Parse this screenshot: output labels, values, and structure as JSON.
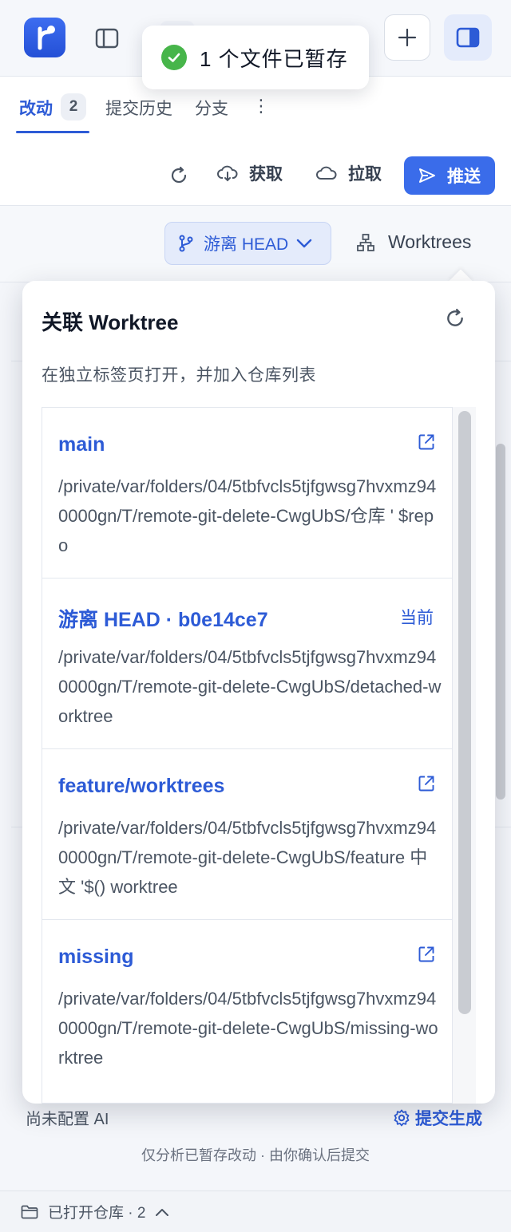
{
  "app": {
    "toast": {
      "message": "1 个文件已暂存"
    }
  },
  "tabs": [
    {
      "label": "改动",
      "badge": "2",
      "active": true
    },
    {
      "label": "提交历史"
    },
    {
      "label": "分支"
    }
  ],
  "toolbar": {
    "fetch_label": "获取",
    "pull_label": "拉取",
    "push_label": "推送"
  },
  "branch": {
    "head_label": "游离 HEAD",
    "worktrees_label": "Worktrees"
  },
  "popover": {
    "title": "关联 Worktree",
    "subtitle": "在独立标签页打开，并加入仓库列表",
    "worktrees": [
      {
        "name": "main",
        "path": "/private/var/folders/04/5tbfvcls5tjfgwsg7hvxmz940000gn/T/remote-git-delete-CwgUbS/仓库 ' $repo",
        "current": false
      },
      {
        "name": "游离 HEAD · b0e14ce7",
        "path": "/private/var/folders/04/5tbfvcls5tjfgwsg7hvxmz940000gn/T/remote-git-delete-CwgUbS/detached-worktree",
        "current": true,
        "current_label": "当前"
      },
      {
        "name": "feature/worktrees",
        "path": "/private/var/folders/04/5tbfvcls5tjfgwsg7hvxmz940000gn/T/remote-git-delete-CwgUbS/feature 中文 '$() worktree",
        "current": false
      },
      {
        "name": "missing",
        "path": "/private/var/folders/04/5tbfvcls5tjfgwsg7hvxmz940000gn/T/remote-git-delete-CwgUbS/missing-worktree",
        "current": false
      }
    ]
  },
  "ai": {
    "status": "尚未配置 AI",
    "generate_label": "提交生成",
    "hint": "仅分析已暂存改动 · 由你确认后提交"
  },
  "footer": {
    "label": "已打开仓库 · 2"
  },
  "colors": {
    "accent": "#2d5bd6",
    "push_bg": "#3a6cea",
    "success": "#47b54a"
  },
  "icons": [
    "app-logo-icon",
    "sidebar-toggle-icon",
    "plus-icon",
    "panel-icon",
    "check-icon",
    "refresh-icon",
    "cloud-download-icon",
    "cloud-icon",
    "send-icon",
    "git-branch-icon",
    "chevron-down-icon",
    "worktree-icon",
    "external-link-icon",
    "gear-icon",
    "folder-icon",
    "chevron-up-icon",
    "more-icon"
  ]
}
